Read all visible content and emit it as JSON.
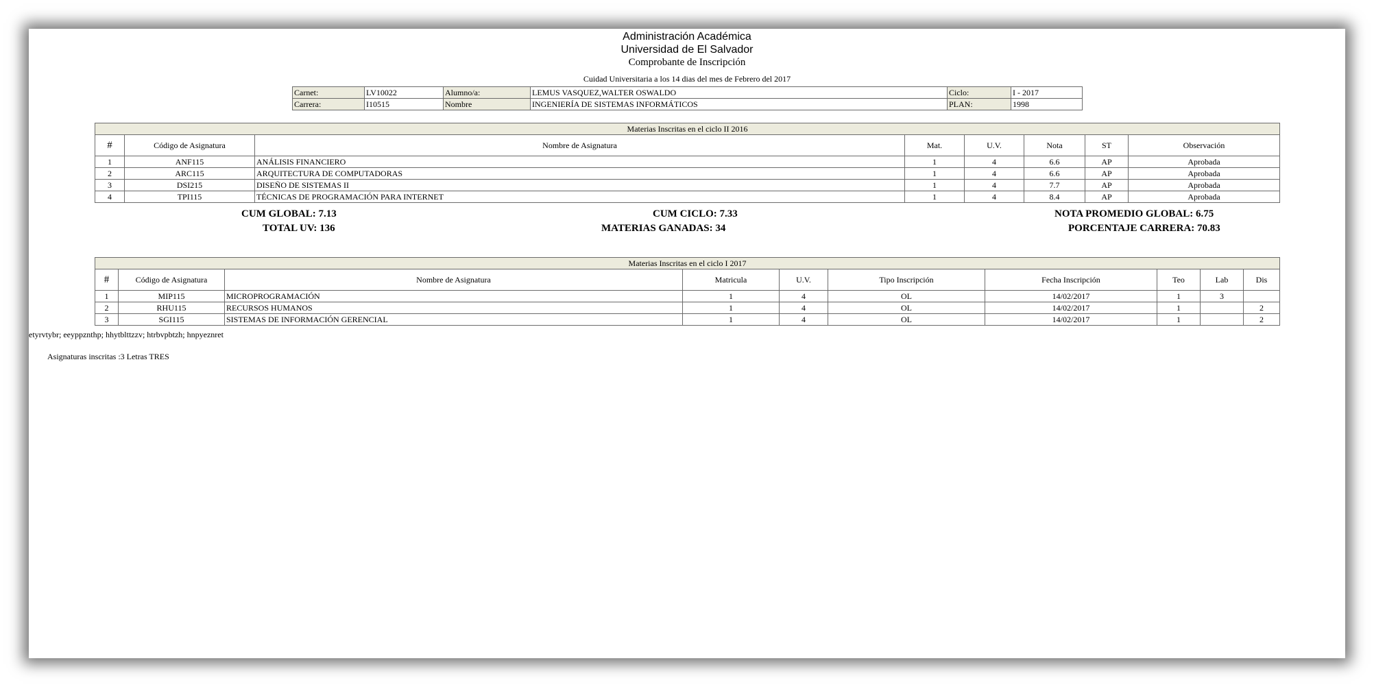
{
  "header": {
    "line1": "Administración Académica",
    "line2": "Universidad de El Salvador",
    "line3": "Comprobante de Inscripción",
    "date_line": "Cuidad Universitaria a los 14 dias del mes de Febrero del 2017"
  },
  "student": {
    "carnet_label": "Carnet:",
    "carnet": "LV10022",
    "alumno_label": "Alumno/a:",
    "alumno": "LEMUS VASQUEZ,WALTER OSWALDO",
    "ciclo_label": "Ciclo:",
    "ciclo": "I - 2017",
    "carrera_label": "Carrera:",
    "carrera": "I10515",
    "nombre_label": "Nombre",
    "nombre": "INGENIERÍA DE SISTEMAS INFORMÁTICOS",
    "plan_label": "PLAN:",
    "plan": "1998"
  },
  "prev": {
    "caption": "Materias Inscritas en el ciclo II 2016",
    "headers": {
      "num": "#",
      "code": "Código de Asignatura",
      "name": "Nombre de Asignatura",
      "mat": "Mat.",
      "uv": "U.V.",
      "nota": "Nota",
      "st": "ST",
      "obs": "Observación"
    },
    "rows": [
      {
        "n": "1",
        "code": "ANF115",
        "name": "ANÁLISIS FINANCIERO",
        "mat": "1",
        "uv": "4",
        "nota": "6.6",
        "st": "AP",
        "obs": "Aprobada"
      },
      {
        "n": "2",
        "code": "ARC115",
        "name": "ARQUITECTURA DE COMPUTADORAS",
        "mat": "1",
        "uv": "4",
        "nota": "6.6",
        "st": "AP",
        "obs": "Aprobada"
      },
      {
        "n": "3",
        "code": "DSI215",
        "name": "DISEÑO DE SISTEMAS II",
        "mat": "1",
        "uv": "4",
        "nota": "7.7",
        "st": "AP",
        "obs": "Aprobada"
      },
      {
        "n": "4",
        "code": "TPI115",
        "name": "TÉCNICAS DE PROGRAMACIÓN PARA INTERNET",
        "mat": "1",
        "uv": "4",
        "nota": "8.4",
        "st": "AP",
        "obs": "Aprobada"
      }
    ]
  },
  "summary": {
    "cum_global": "CUM GLOBAL: 7.13",
    "cum_ciclo": "CUM CICLO: 7.33",
    "nota_promedio": "NOTA PROMEDIO GLOBAL: 6.75",
    "total_uv": "TOTAL UV: 136",
    "materias_ganadas": "MATERIAS GANADAS: 34",
    "porcentaje": "PORCENTAJE CARRERA: 70.83"
  },
  "current": {
    "caption": "Materias Inscritas en el ciclo I 2017",
    "headers": {
      "num": "#",
      "code": "Código de Asignatura",
      "name": "Nombre de Asignatura",
      "matricula": "Matricula",
      "uv": "U.V.",
      "tipo": "Tipo Inscripción",
      "fecha": "Fecha Inscripción",
      "teo": "Teo",
      "lab": "Lab",
      "dis": "Dis"
    },
    "rows": [
      {
        "n": "1",
        "code": "MIP115",
        "name": "MICROPROGRAMACIÓN",
        "matricula": "1",
        "uv": "4",
        "tipo": "OL",
        "fecha": "14/02/2017",
        "teo": "1",
        "lab": "3",
        "dis": ""
      },
      {
        "n": "2",
        "code": "RHU115",
        "name": "RECURSOS HUMANOS",
        "matricula": "1",
        "uv": "4",
        "tipo": "OL",
        "fecha": "14/02/2017",
        "teo": "1",
        "lab": "",
        "dis": "2"
      },
      {
        "n": "3",
        "code": "SGI115",
        "name": "SISTEMAS DE INFORMACIÓN GERENCIAL",
        "matricula": "1",
        "uv": "4",
        "tipo": "OL",
        "fecha": "14/02/2017",
        "teo": "1",
        "lab": "",
        "dis": "2"
      }
    ]
  },
  "footer": {
    "code_line": "etyrvtybr; eeyppznthp; hhytblttzzv; htrbvpbtzh; hnpyeznret",
    "count_line": "Asignaturas inscritas :3 Letras TRES"
  }
}
